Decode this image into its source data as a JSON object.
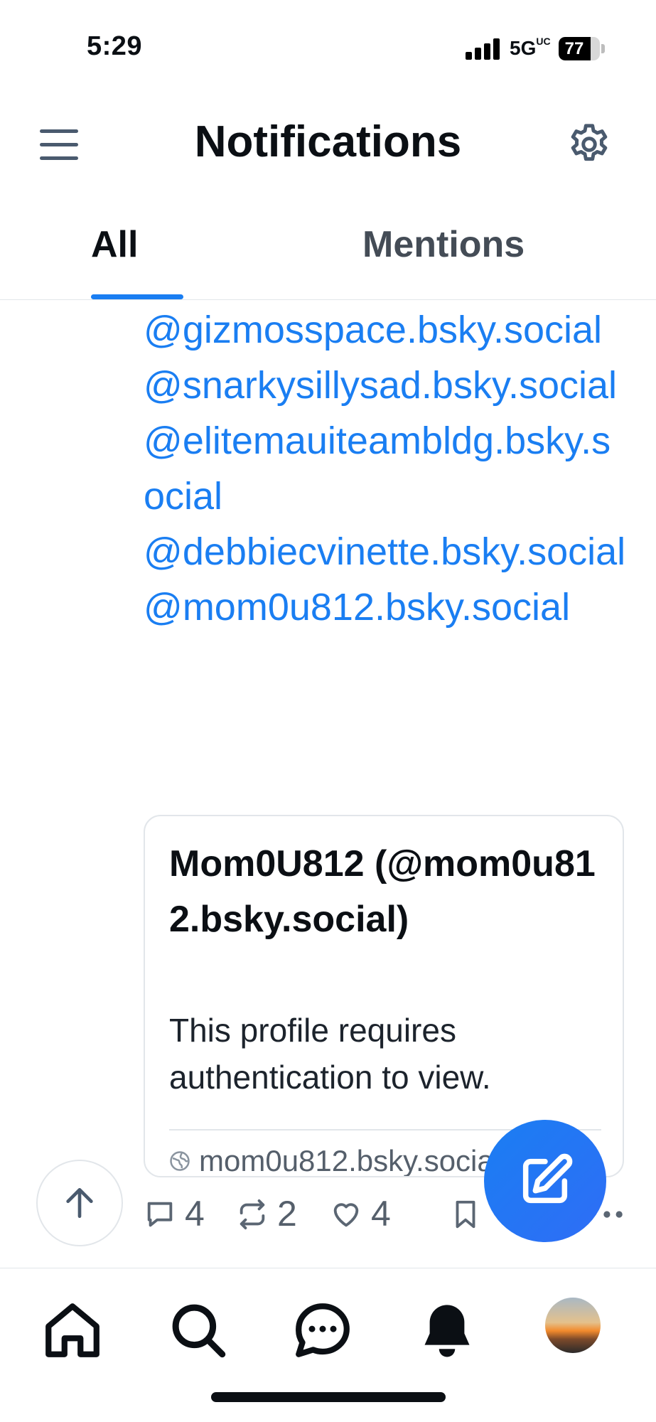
{
  "status_bar": {
    "time": "5:29",
    "network": "5G",
    "network_sup": "UC",
    "battery": "77",
    "battery_level": 0.77
  },
  "header": {
    "title": "Notifications",
    "menu_icon": "hamburger-menu-icon",
    "settings_icon": "gear-icon"
  },
  "tabs": [
    {
      "label": "All",
      "selected": true
    },
    {
      "label": "Mentions",
      "selected": false
    }
  ],
  "mentions": [
    "@gizmosspace.bsky.social",
    "@snarkysillysad.bsky.social",
    "@elitemauiteambldg.bsky.social",
    "@debbiecvinette.bsky.social",
    "@mom0u812.bsky.social"
  ],
  "embed": {
    "title": "Mom0U812 (@mom0u812.bsky.social)",
    "description": "This profile requires authentication to view.",
    "domain": "mom0u812.bsky.social",
    "domain_icon": "globe-icon"
  },
  "post_actions": {
    "reply_count": "4",
    "repost_count": "2",
    "like_count": "4"
  },
  "bottom_nav": {
    "items": [
      "home-icon",
      "search-icon",
      "chat-icon",
      "bell-icon",
      "avatar"
    ]
  },
  "colors": {
    "accent": "#1a7ef2",
    "text": "#0b0f14",
    "muted": "#555f6b",
    "border": "#e2e6ea"
  }
}
